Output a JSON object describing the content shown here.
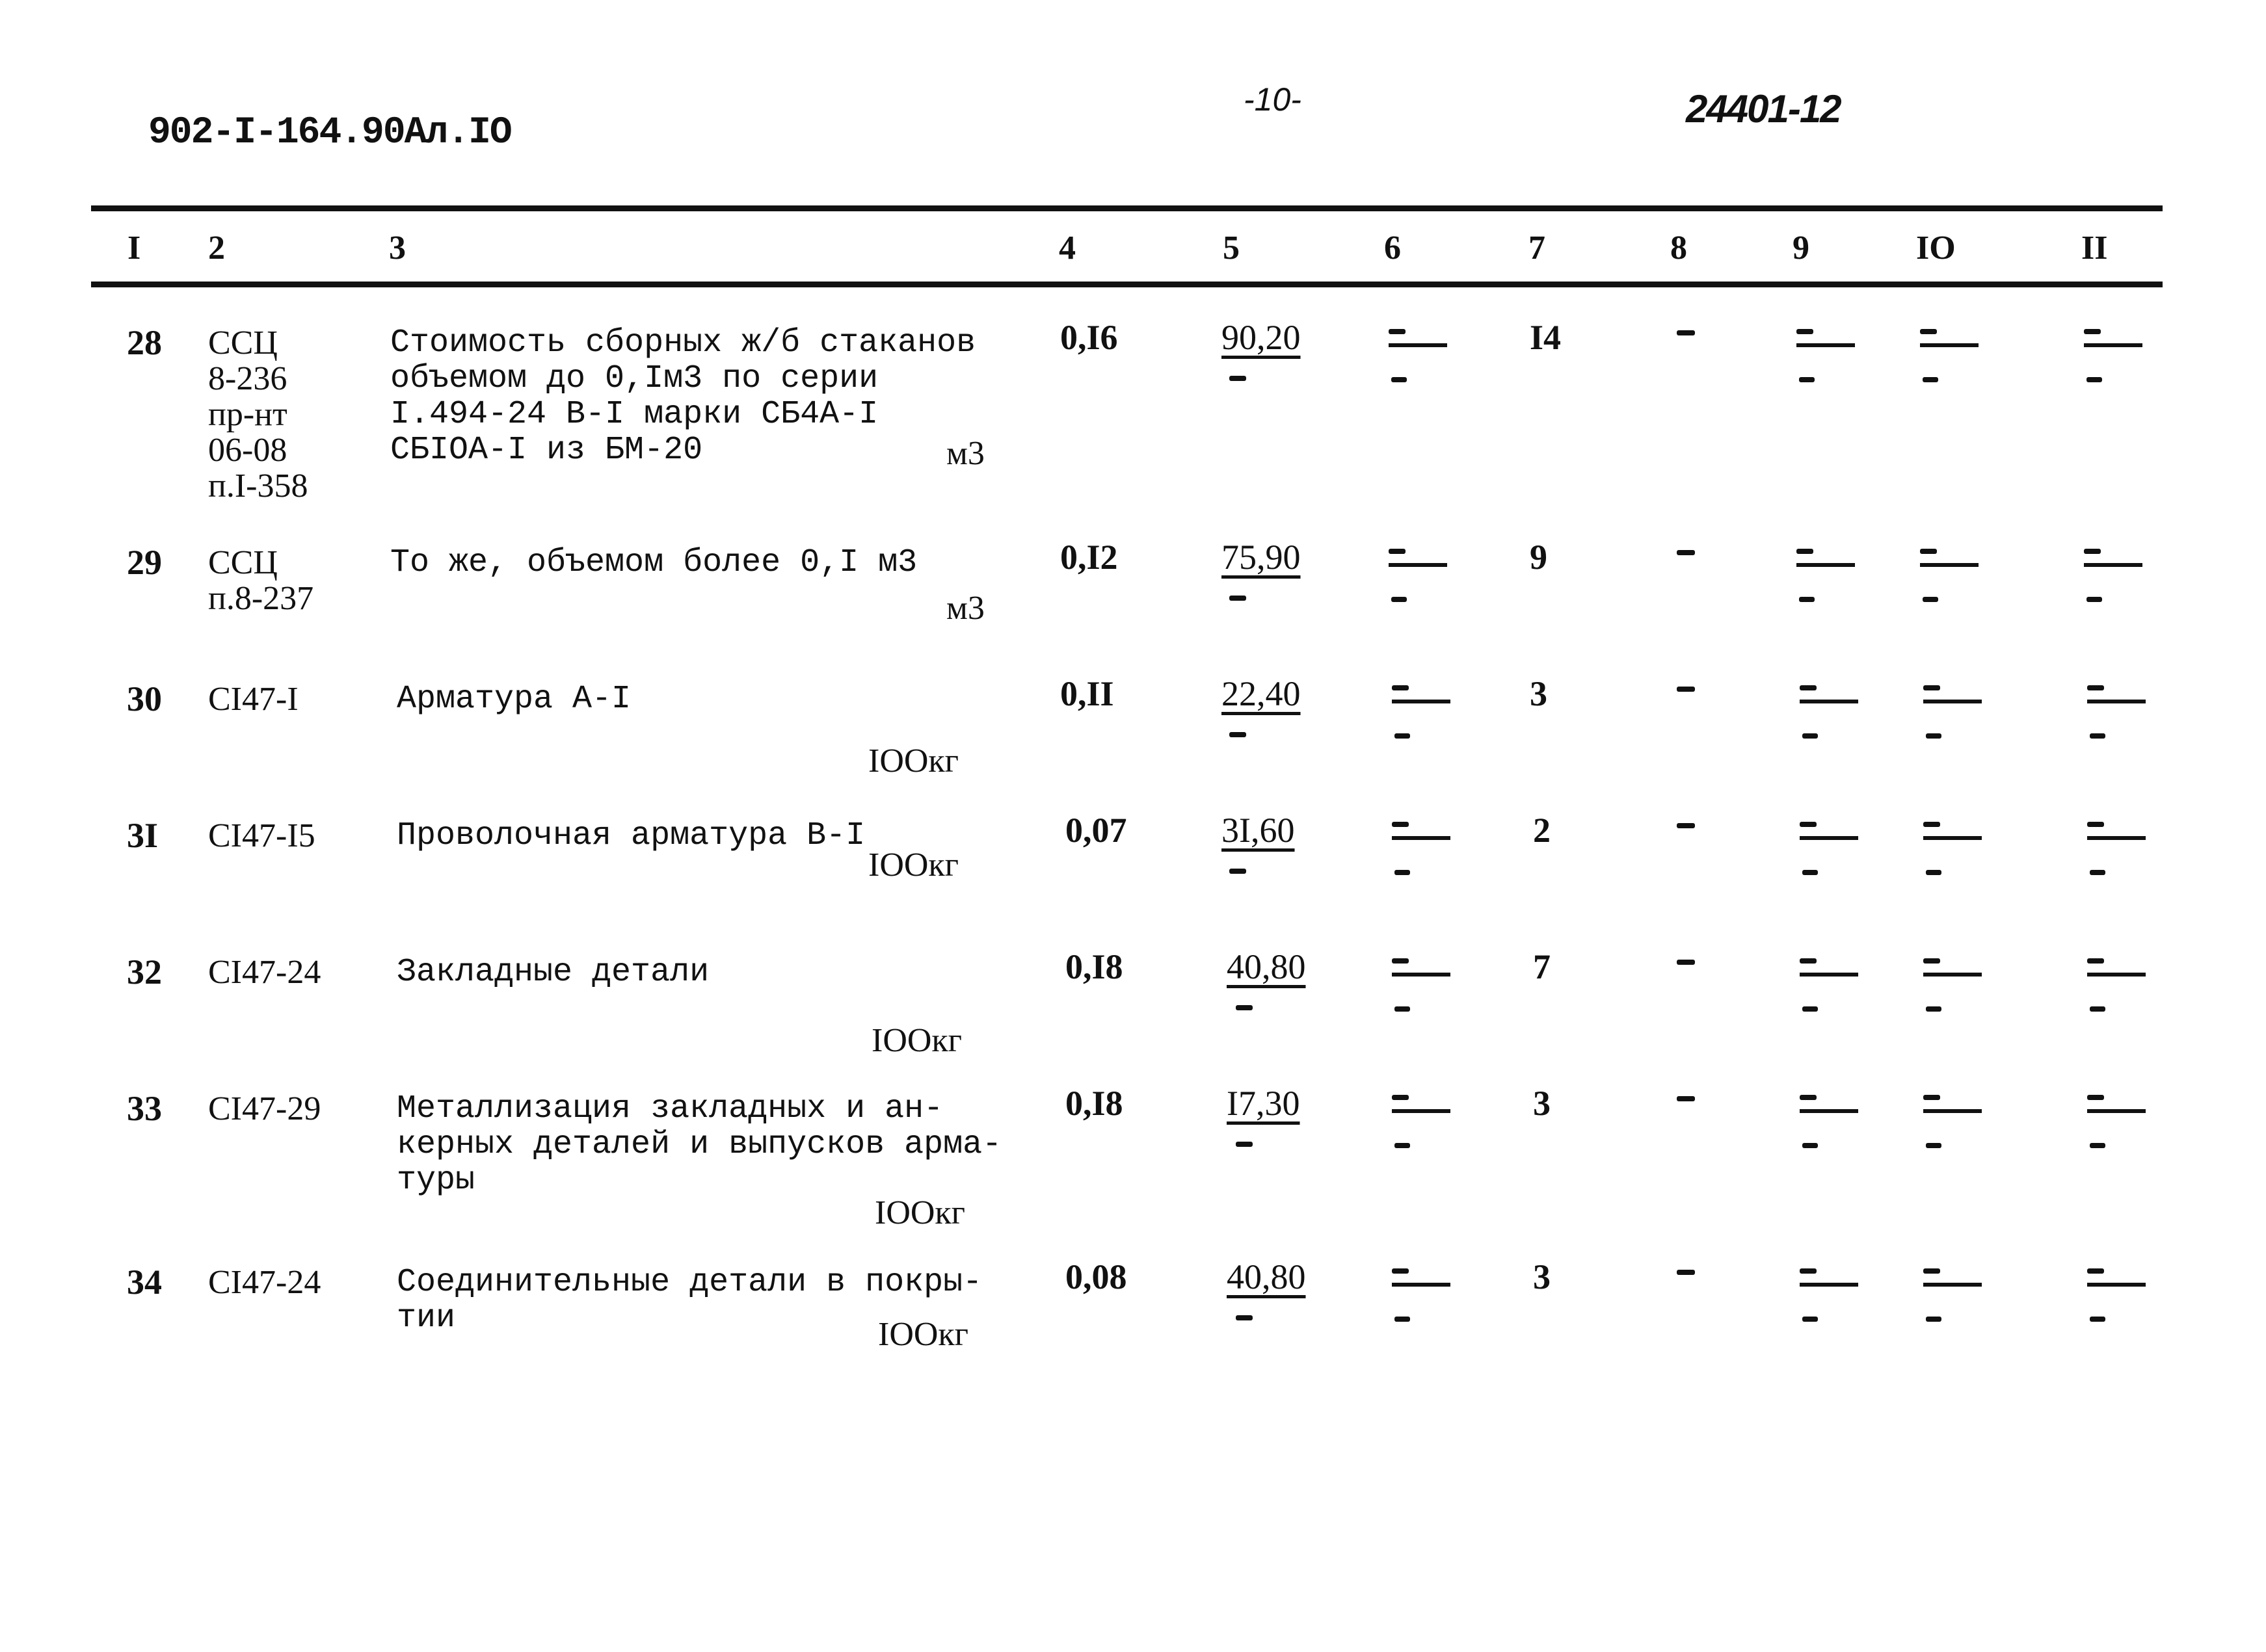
{
  "header": {
    "project_code": "902-I-164.90Ал.IO",
    "page_number": "-10-",
    "document_number": "24401-12"
  },
  "table": {
    "column_numbers": [
      "I",
      "2",
      "3",
      "4",
      "5",
      "6",
      "7",
      "8",
      "9",
      "IO",
      "II"
    ],
    "rows": [
      {
        "n": "28",
        "code": "ССЦ\n8-236\nпр-нт\n06-08\nп.I-358",
        "description": "Стоимость сборных ж/б стаканов\nобъемом до 0,Iм3 по серии\nI.494-24 В-I марки СБ4А-I\nСБIОА-I из БМ-20",
        "unit": "м3",
        "col4": "0,I6",
        "col5": "90,20",
        "col6": "-",
        "col7": "I4",
        "col8": "-",
        "col9": "-",
        "col10": "-",
        "col11": "-"
      },
      {
        "n": "29",
        "code": "ССЦ\nп.8-237",
        "description": "То же, объемом более 0,I м3",
        "unit": "м3",
        "col4": "0,I2",
        "col5": "75,90",
        "col6": "-",
        "col7": "9",
        "col8": "-",
        "col9": "-",
        "col10": "-",
        "col11": "-"
      },
      {
        "n": "30",
        "code": "СI47-I",
        "description": "Арматура А-I",
        "unit": "IOOкг",
        "col4": "0,II",
        "col5": "22,40",
        "col6": "-",
        "col7": "3",
        "col8": "-",
        "col9": "-",
        "col10": "-",
        "col11": "-"
      },
      {
        "n": "3I",
        "code": "СI47-I5",
        "description": "Проволочная арматура В-I",
        "unit": "IOOкг",
        "col4": "0,07",
        "col5": "3I,60",
        "col6": "-",
        "col7": "2",
        "col8": "-",
        "col9": "-",
        "col10": "-",
        "col11": "-"
      },
      {
        "n": "32",
        "code": "СI47-24",
        "description": "Закладные детали",
        "unit": "IOOкг",
        "col4": "0,I8",
        "col5": "40,80",
        "col6": "-",
        "col7": "7",
        "col8": "-",
        "col9": "-",
        "col10": "-",
        "col11": "-"
      },
      {
        "n": "33",
        "code": "СI47-29",
        "description": "Металлизация закладных и ан-\nкерных деталей и выпусков арма-\nтуры",
        "unit": "IOOкг",
        "col4": "0,I8",
        "col5": "I7,30",
        "col6": "-",
        "col7": "3",
        "col8": "-",
        "col9": "-",
        "col10": "-",
        "col11": "-"
      },
      {
        "n": "34",
        "code": "СI47-24",
        "description": "Соединительные детали в покры-\nтии",
        "unit": "IOOкг",
        "col4": "0,08",
        "col5": "40,80",
        "col6": "-",
        "col7": "3",
        "col8": "-",
        "col9": "-",
        "col10": "-",
        "col11": "-"
      }
    ]
  }
}
